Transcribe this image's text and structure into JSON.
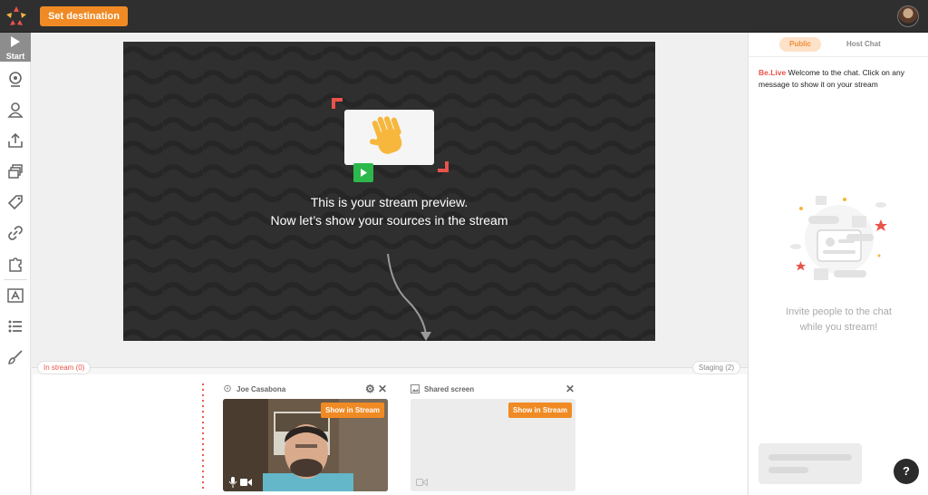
{
  "topbar": {
    "set_destination_label": "Set destination"
  },
  "sidebar": {
    "start_label": "Start",
    "icons": [
      "webcam-icon",
      "person-icon",
      "upload-icon",
      "layers-icon",
      "tag-icon",
      "link-icon",
      "puzzle-icon",
      "text-box-icon",
      "list-icon",
      "brush-icon"
    ]
  },
  "preview": {
    "line1": "This is your stream preview.",
    "line2": "Now let’s show your sources in the stream"
  },
  "bottom": {
    "in_stream_label": "In stream (0)",
    "staging_label": "Staging (2)",
    "sources": [
      {
        "name": "Joe Casabona",
        "show_label": "Show in Stream"
      },
      {
        "name": "Shared screen",
        "show_label": "Show in Stream"
      }
    ]
  },
  "chat": {
    "tab_public": "Public",
    "tab_host": "Host Chat",
    "brand": "Be.Live",
    "welcome": " Welcome to the chat. Click on any message to show it on your stream",
    "invite_line1": "Invite people to the chat",
    "invite_line2": "while you stream!",
    "help_label": "?"
  },
  "colors": {
    "accent": "#f08a24",
    "brand_red": "#e8534a",
    "dark": "#2f2f2f"
  }
}
